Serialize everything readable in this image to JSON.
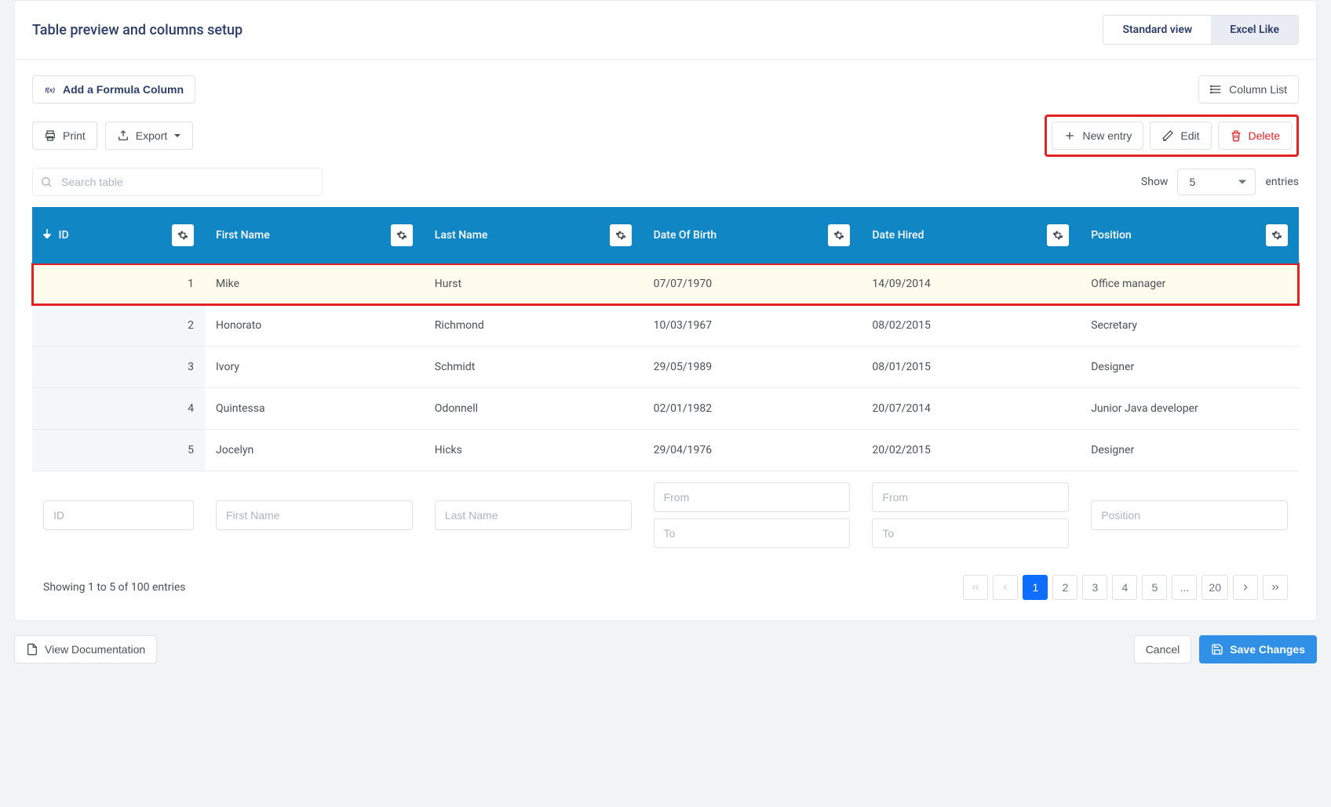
{
  "header": {
    "title": "Table preview and columns setup",
    "view_standard": "Standard view",
    "view_excel": "Excel Like"
  },
  "toolbar": {
    "formula": "Add a Formula Column",
    "print": "Print",
    "export": "Export",
    "column_list": "Column List",
    "new_entry": "New entry",
    "edit": "Edit",
    "delete": "Delete",
    "search_placeholder": "Search table",
    "show_label": "Show",
    "entries_label": "entries",
    "page_size": "5"
  },
  "columns": {
    "id": "ID",
    "first_name": "First Name",
    "last_name": "Last Name",
    "dob": "Date Of Birth",
    "hired": "Date Hired",
    "position": "Position"
  },
  "rows": [
    {
      "id": "1",
      "first": "Mike",
      "last": "Hurst",
      "dob": "07/07/1970",
      "hired": "14/09/2014",
      "position": "Office manager",
      "selected": true
    },
    {
      "id": "2",
      "first": "Honorato",
      "last": "Richmond",
      "dob": "10/03/1967",
      "hired": "08/02/2015",
      "position": "Secretary",
      "selected": false
    },
    {
      "id": "3",
      "first": "Ivory",
      "last": "Schmidt",
      "dob": "29/05/1989",
      "hired": "08/01/2015",
      "position": "Designer",
      "selected": false
    },
    {
      "id": "4",
      "first": "Quintessa",
      "last": "Odonnell",
      "dob": "02/01/1982",
      "hired": "20/07/2014",
      "position": "Junior Java developer",
      "selected": false
    },
    {
      "id": "5",
      "first": "Jocelyn",
      "last": "Hicks",
      "dob": "29/04/1976",
      "hired": "20/02/2015",
      "position": "Designer",
      "selected": false
    }
  ],
  "filters": {
    "id": "ID",
    "first": "First Name",
    "last": "Last Name",
    "from": "From",
    "to": "To",
    "position": "Position"
  },
  "footer": {
    "info": "Showing 1 to 5 of 100 entries",
    "pages": [
      "1",
      "2",
      "3",
      "4",
      "5",
      "...",
      "20"
    ],
    "active_page": "1"
  },
  "bottom": {
    "docs": "View Documentation",
    "cancel": "Cancel",
    "save": "Save Changes"
  }
}
